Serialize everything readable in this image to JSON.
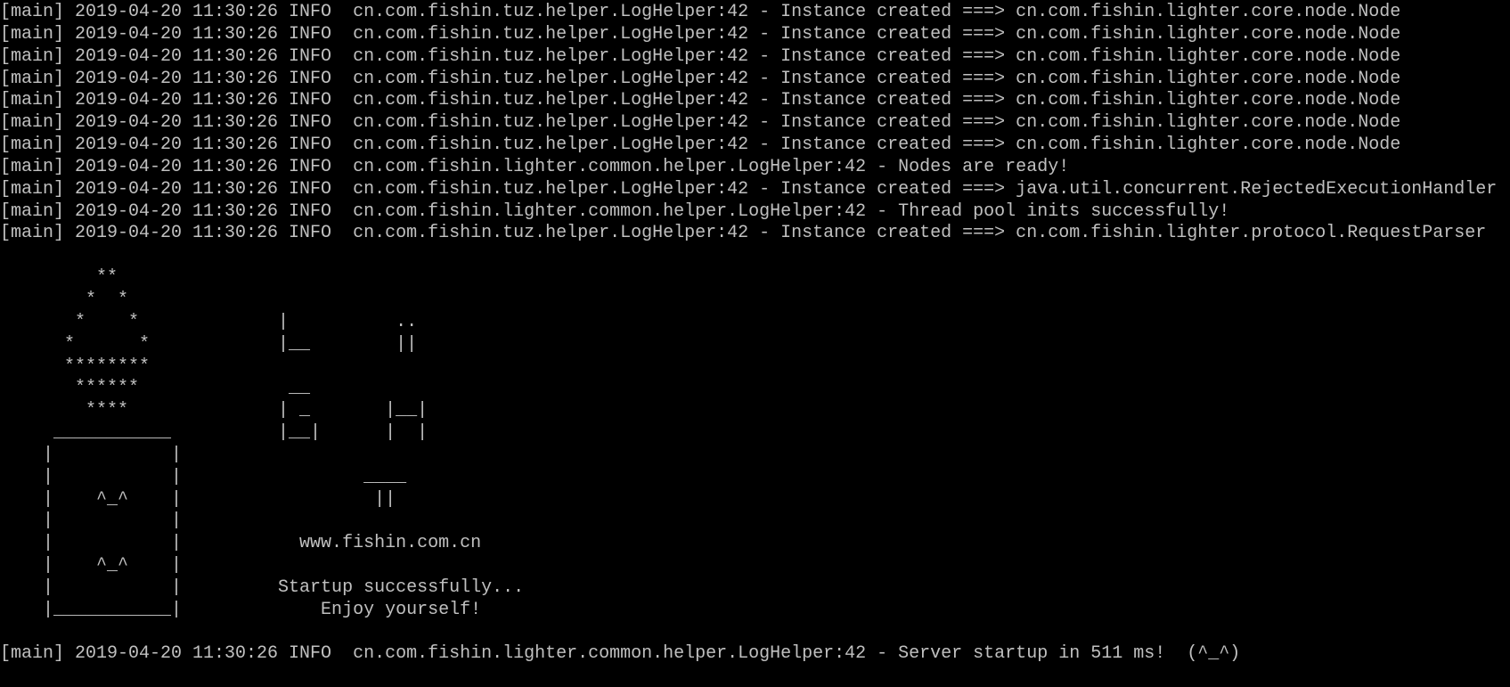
{
  "colors": {
    "background": "#000000",
    "foreground": "#c0c0c0"
  },
  "terminal": {
    "lines": [
      "[main] 2019-04-20 11:30:26 INFO  cn.com.fishin.tuz.helper.LogHelper:42 - Instance created ===> cn.com.fishin.lighter.core.node.Node",
      "[main] 2019-04-20 11:30:26 INFO  cn.com.fishin.tuz.helper.LogHelper:42 - Instance created ===> cn.com.fishin.lighter.core.node.Node",
      "[main] 2019-04-20 11:30:26 INFO  cn.com.fishin.tuz.helper.LogHelper:42 - Instance created ===> cn.com.fishin.lighter.core.node.Node",
      "[main] 2019-04-20 11:30:26 INFO  cn.com.fishin.tuz.helper.LogHelper:42 - Instance created ===> cn.com.fishin.lighter.core.node.Node",
      "[main] 2019-04-20 11:30:26 INFO  cn.com.fishin.tuz.helper.LogHelper:42 - Instance created ===> cn.com.fishin.lighter.core.node.Node",
      "[main] 2019-04-20 11:30:26 INFO  cn.com.fishin.tuz.helper.LogHelper:42 - Instance created ===> cn.com.fishin.lighter.core.node.Node",
      "[main] 2019-04-20 11:30:26 INFO  cn.com.fishin.tuz.helper.LogHelper:42 - Instance created ===> cn.com.fishin.lighter.core.node.Node",
      "[main] 2019-04-20 11:30:26 INFO  cn.com.fishin.lighter.common.helper.LogHelper:42 - Nodes are ready!",
      "[main] 2019-04-20 11:30:26 INFO  cn.com.fishin.tuz.helper.LogHelper:42 - Instance created ===> java.util.concurrent.RejectedExecutionHandler",
      "[main] 2019-04-20 11:30:26 INFO  cn.com.fishin.lighter.common.helper.LogHelper:42 - Thread pool inits successfully!",
      "[main] 2019-04-20 11:30:26 INFO  cn.com.fishin.tuz.helper.LogHelper:42 - Instance created ===> cn.com.fishin.lighter.protocol.RequestParser",
      "",
      "         **",
      "        *  *",
      "       *    *             |          ..",
      "      *      *            |__        ||",
      "      ********",
      "       ******              __",
      "        ****              | _       |__|",
      "     ___________          |__|      |  |",
      "    |           |",
      "    |           |                 ____",
      "    |    ^_^    |                  ||",
      "    |           |",
      "    |           |           www.fishin.com.cn",
      "    |    ^_^    |",
      "    |           |         Startup successfully...",
      "    |___________|             Enjoy yourself!",
      "",
      "[main] 2019-04-20 11:30:26 INFO  cn.com.fishin.lighter.common.helper.LogHelper:42 - Server startup in 511 ms!  (^_^)"
    ]
  }
}
